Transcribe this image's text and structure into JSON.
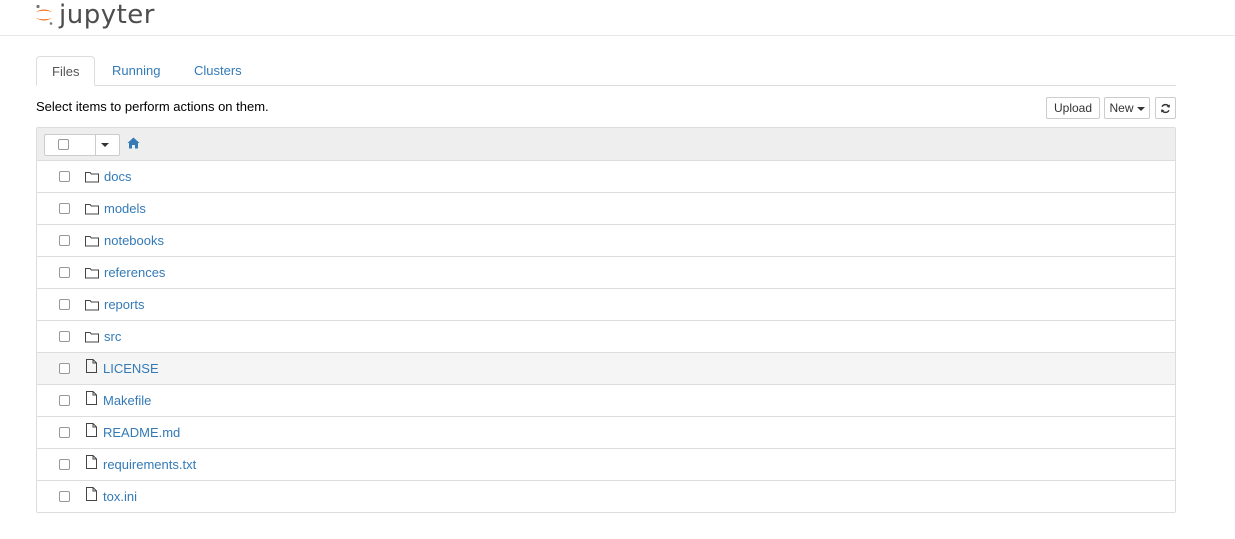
{
  "brand": {
    "name": "jupyter",
    "logo_colors": {
      "orange": "#F37726",
      "gray": "#767677"
    }
  },
  "tabs": [
    {
      "label": "Files",
      "active": true
    },
    {
      "label": "Running",
      "active": false
    },
    {
      "label": "Clusters",
      "active": false
    }
  ],
  "toolbar": {
    "instructions": "Select items to perform actions on them.",
    "upload_label": "Upload",
    "new_label": "New",
    "refresh_icon": "refresh-icon"
  },
  "file_list": {
    "home_icon": "home-icon",
    "items": [
      {
        "name": "docs",
        "type": "folder"
      },
      {
        "name": "models",
        "type": "folder"
      },
      {
        "name": "notebooks",
        "type": "folder"
      },
      {
        "name": "references",
        "type": "folder"
      },
      {
        "name": "reports",
        "type": "folder"
      },
      {
        "name": "src",
        "type": "folder"
      },
      {
        "name": "LICENSE",
        "type": "file"
      },
      {
        "name": "Makefile",
        "type": "file"
      },
      {
        "name": "README.md",
        "type": "file"
      },
      {
        "name": "requirements.txt",
        "type": "file"
      },
      {
        "name": "tox.ini",
        "type": "file"
      }
    ]
  },
  "colors": {
    "link": "#337ab7",
    "border": "#dddddd",
    "header_bg": "#eeeeee",
    "hover_bg": "#f5f5f5"
  }
}
